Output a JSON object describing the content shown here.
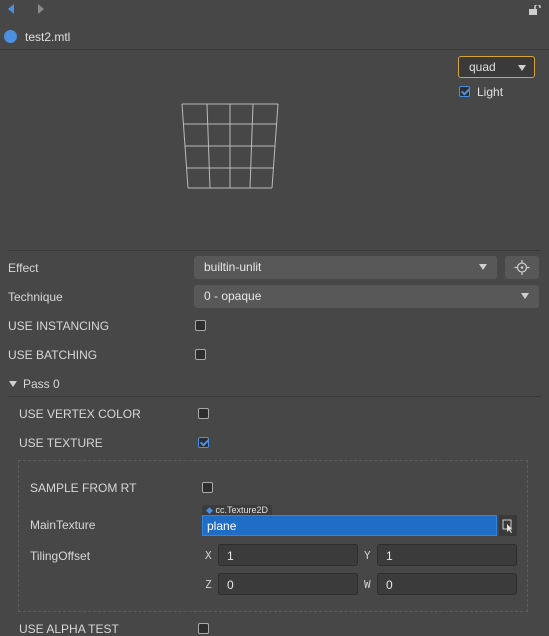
{
  "header": {
    "file_name": "test2.mtl"
  },
  "preview": {
    "mesh_select": "quad",
    "light_label": "Light",
    "light_checked": true
  },
  "properties": {
    "effect": {
      "label": "Effect",
      "value": "builtin-unlit"
    },
    "technique": {
      "label": "Technique",
      "value": "0 - opaque"
    },
    "use_instancing": {
      "label": "USE INSTANCING",
      "checked": false
    },
    "use_batching": {
      "label": "USE BATCHING",
      "checked": false
    }
  },
  "pass": {
    "title": "Pass 0",
    "use_vertex_color": {
      "label": "USE VERTEX COLOR",
      "checked": false
    },
    "use_texture": {
      "label": "USE TEXTURE",
      "checked": true
    },
    "sample_from_rt": {
      "label": "SAMPLE FROM RT",
      "checked": false
    },
    "main_texture": {
      "label": "MainTexture",
      "type_badge": "cc.Texture2D",
      "value": "plane"
    },
    "tiling_offset": {
      "label": "TilingOffset",
      "x_label": "X",
      "x": "1",
      "y_label": "Y",
      "y": "1",
      "z_label": "Z",
      "z": "0",
      "w_label": "W",
      "w": "0"
    },
    "use_alpha_test": {
      "label": "USE ALPHA TEST",
      "checked": false
    }
  },
  "colors": {
    "accent": "#4a8fe0",
    "selected_field": "#1f6dc5",
    "preview_border": "#d6a43a"
  }
}
